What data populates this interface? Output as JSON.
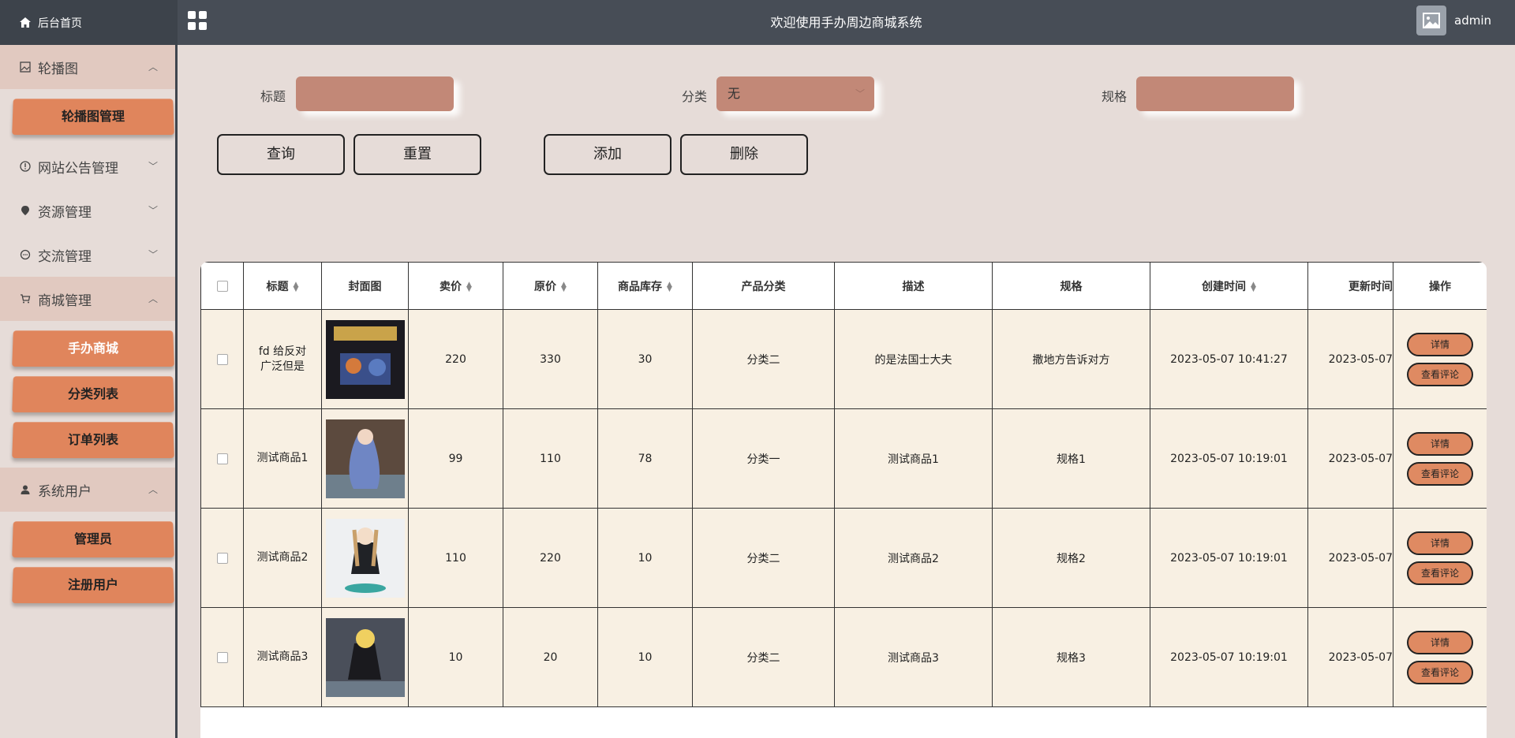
{
  "header": {
    "home_label": "后台首页",
    "app_title": "欢迎使用手办周边商城系统",
    "username": "admin"
  },
  "sidebar": {
    "groups": [
      {
        "label": "轮播图",
        "expanded": true,
        "items": [
          "轮播图管理"
        ]
      },
      {
        "label": "网站公告管理",
        "expanded": false,
        "items": []
      },
      {
        "label": "资源管理",
        "expanded": false,
        "items": []
      },
      {
        "label": "交流管理",
        "expanded": false,
        "items": []
      },
      {
        "label": "商城管理",
        "expanded": true,
        "items": [
          "手办商城",
          "分类列表",
          "订单列表"
        ]
      },
      {
        "label": "系统用户",
        "expanded": true,
        "items": [
          "管理员",
          "注册用户"
        ]
      }
    ],
    "active_item": "手办商城"
  },
  "search": {
    "title_label": "标题",
    "title_value": "",
    "category_label": "分类",
    "category_value": "无",
    "spec_label": "规格",
    "spec_value": ""
  },
  "actions": {
    "query": "查询",
    "reset": "重置",
    "add": "添加",
    "delete": "删除"
  },
  "table": {
    "columns": [
      "标题",
      "封面图",
      "卖价",
      "原价",
      "商品库存",
      "产品分类",
      "描述",
      "规格",
      "创建时间",
      "更新时间",
      "操作"
    ],
    "rows": [
      {
        "title": "fd 给反对广泛但是",
        "price": "220",
        "original": "330",
        "stock": "30",
        "category": "分类二",
        "desc": "的是法国士大夫",
        "spec": "撒地方告诉对方",
        "created": "2023-05-07 10:41:27",
        "updated": "2023-05-07",
        "cover": "dark-poster"
      },
      {
        "title": "测试商品1",
        "price": "99",
        "original": "110",
        "stock": "78",
        "category": "分类一",
        "desc": "测试商品1",
        "spec": "规格1",
        "created": "2023-05-07 10:19:01",
        "updated": "2023-05-07",
        "cover": "blue-figure"
      },
      {
        "title": "测试商品2",
        "price": "110",
        "original": "220",
        "stock": "10",
        "category": "分类二",
        "desc": "测试商品2",
        "spec": "规格2",
        "created": "2023-05-07 10:19:01",
        "updated": "2023-05-07",
        "cover": "white-figure"
      },
      {
        "title": "测试商品3",
        "price": "10",
        "original": "20",
        "stock": "10",
        "category": "分类二",
        "desc": "测试商品3",
        "spec": "规格3",
        "created": "2023-05-07 10:19:01",
        "updated": "2023-05-07",
        "cover": "dark-figure"
      }
    ],
    "detail_label": "详情",
    "review_label": "查看评论"
  }
}
